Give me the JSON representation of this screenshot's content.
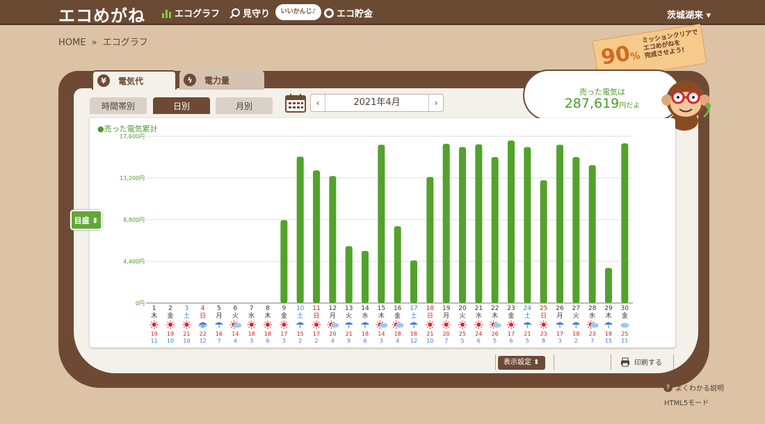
{
  "header": {
    "logo": "エコめがね",
    "nav": [
      {
        "label": "エコグラフ",
        "icon": "graph-icon"
      },
      {
        "label": "見守り",
        "icon": "magnifier-icon"
      },
      {
        "label": "エコ貯金",
        "icon": "coin-icon"
      }
    ],
    "pill": "いいかんじ♪",
    "user": "茨城湖来 ▾"
  },
  "breadcrumb": {
    "home": "HOME",
    "sep": "»",
    "current": "エコグラフ"
  },
  "mission": {
    "percent": "90",
    "unit": "%",
    "text1": "ミッションクリアで",
    "text2": "エコめがねを",
    "text3": "完成させよう!"
  },
  "tabs": {
    "denki": "電気代",
    "ryo": "電力量"
  },
  "subtabs": {
    "hour": "時間帯別",
    "day": "日別",
    "month": "月別"
  },
  "month_selector": {
    "label": "2021年4月",
    "prev": "‹",
    "next": "›"
  },
  "sold": {
    "title": "売った電気は",
    "value": "287,619",
    "unit": "円だよ"
  },
  "memori": "目盛 ⬍",
  "controls": {
    "display": "表示設定 ⬍",
    "print": "印刷する",
    "help": "よくわかる説明",
    "html5": "HTML5モード"
  },
  "chart_data": {
    "type": "bar",
    "legend": "●売った電気累計",
    "ylim": [
      0,
      17600
    ],
    "yticks": [
      "0円",
      "4,400円",
      "8,800円",
      "13,200円",
      "17,600円"
    ],
    "tick_values": [
      0,
      4400,
      8800,
      13200,
      17600
    ],
    "bar_color": "#52a22b",
    "days": [
      1,
      2,
      3,
      4,
      5,
      6,
      7,
      8,
      9,
      10,
      11,
      12,
      13,
      14,
      15,
      16,
      17,
      18,
      19,
      20,
      21,
      22,
      23,
      24,
      25,
      26,
      27,
      28,
      29,
      30
    ],
    "weekdays": [
      "木",
      "金",
      "土",
      "日",
      "月",
      "火",
      "水",
      "木",
      "金",
      "土",
      "日",
      "月",
      "火",
      "水",
      "木",
      "金",
      "土",
      "日",
      "月",
      "火",
      "水",
      "木",
      "金",
      "土",
      "日",
      "月",
      "火",
      "水",
      "木",
      "金"
    ],
    "values": [
      0,
      0,
      0,
      0,
      0,
      0,
      0,
      0,
      8750,
      15450,
      14000,
      13400,
      6000,
      5500,
      16700,
      8100,
      4500,
      13300,
      16800,
      16450,
      16750,
      15400,
      17150,
      16450,
      12950,
      16700,
      15400,
      14550,
      3700,
      16850
    ],
    "weather": [
      "sunny",
      "sunny",
      "sunny",
      "cloudy-rain",
      "rain",
      "sunny-cloudy",
      "sunny",
      "sunny",
      "sunny",
      "rain",
      "sunny",
      "sunny-cloudy",
      "rain",
      "rain",
      "sunny-cloudy",
      "sunny-cloudy",
      "rain",
      "sunny",
      "sunny",
      "sunny",
      "sunny",
      "sunny-cloudy",
      "sunny",
      "rain",
      "sunny",
      "rain",
      "rain",
      "sunny-cloudy",
      "rain",
      "cloudy"
    ],
    "high": [
      19,
      19,
      21,
      22,
      16,
      14,
      18,
      18,
      17,
      15,
      17,
      20,
      21,
      18,
      14,
      18,
      18,
      21,
      20,
      25,
      24,
      26,
      17,
      21,
      23,
      17,
      18,
      23,
      18,
      25
    ],
    "low": [
      11,
      10,
      10,
      12,
      7,
      4,
      3,
      6,
      3,
      2,
      2,
      4,
      9,
      6,
      3,
      4,
      12,
      10,
      7,
      5,
      6,
      5,
      6,
      5,
      8,
      3,
      2,
      7,
      15,
      11
    ],
    "saturday_color": "#3a7fd5",
    "sunday_color": "#d0201c"
  }
}
